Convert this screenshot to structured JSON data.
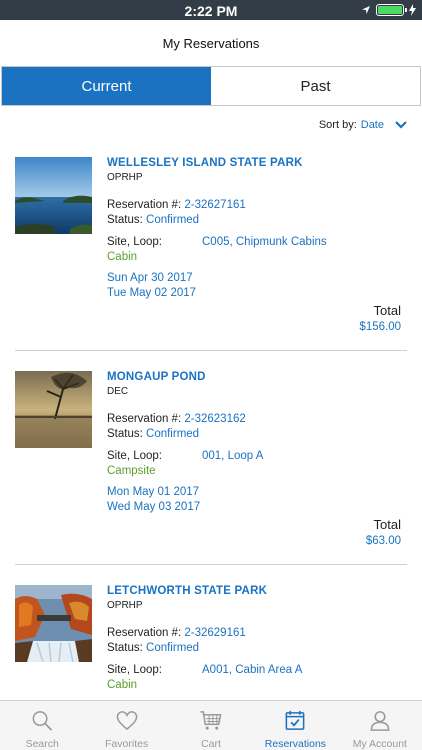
{
  "status_bar": {
    "time": "2:22 PM"
  },
  "header": {
    "title": "My Reservations"
  },
  "tabs": {
    "current": "Current",
    "past": "Past"
  },
  "sort": {
    "label": "Sort by:",
    "value": "Date"
  },
  "reservations": [
    {
      "name": "WELLESLEY ISLAND STATE PARK",
      "agency": "OPRHP",
      "res_label": "Reservation #:",
      "res_number": "2-32627161",
      "status_label": "Status:",
      "status": "Confirmed",
      "site_label": "Site, Loop:",
      "site": "C005, Chipmunk Cabins",
      "type": "Cabin",
      "start": "Sun Apr 30 2017",
      "end": "Tue May 02 2017",
      "total_label": "Total",
      "total": "$156.00"
    },
    {
      "name": "MONGAUP POND",
      "agency": "DEC",
      "res_label": "Reservation #:",
      "res_number": "2-32623162",
      "status_label": "Status:",
      "status": "Confirmed",
      "site_label": "Site, Loop:",
      "site": "001, Loop A",
      "type": "Campsite",
      "start": "Mon May 01 2017",
      "end": "Wed May 03 2017",
      "total_label": "Total",
      "total": "$63.00"
    },
    {
      "name": "LETCHWORTH STATE PARK",
      "agency": "OPRHP",
      "res_label": "Reservation #:",
      "res_number": "2-32629161",
      "status_label": "Status:",
      "status": "Confirmed",
      "site_label": "Site, Loop:",
      "site": "A001, Cabin Area A",
      "type": "Cabin"
    }
  ],
  "tabbar": [
    {
      "label": "Search",
      "icon": "search-icon"
    },
    {
      "label": "Favorites",
      "icon": "heart-icon"
    },
    {
      "label": "Cart",
      "icon": "cart-icon"
    },
    {
      "label": "Reservations",
      "icon": "calendar-check-icon"
    },
    {
      "label": "My Account",
      "icon": "person-icon"
    }
  ],
  "colors": {
    "accent": "#1a72c1",
    "status_bar": "#323d47",
    "site_type": "#5a9e2c"
  }
}
